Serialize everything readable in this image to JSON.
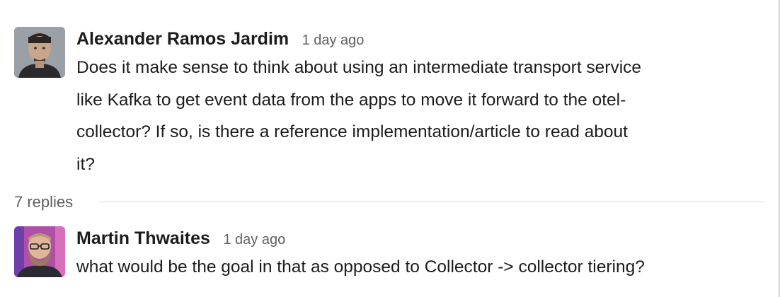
{
  "thread": {
    "parent": {
      "author": "Alexander Ramos Jardim",
      "timestamp": "1 day ago",
      "avatar_icon": "user-avatar-photo",
      "text_lines": [
        "Does it make sense to think about using an intermediate transport service",
        "like Kafka to get event data from the apps to move it forward to the otel-",
        "collector?  If so, is there a reference implementation/article to read about",
        "it?"
      ]
    },
    "replies_label": "7 replies",
    "reply": {
      "author": "Martin Thwaites",
      "timestamp": "1 day ago",
      "avatar_icon": "user-avatar-photo",
      "text_lines": [
        "what would be the goal in that as opposed to Collector -> collector tiering?"
      ]
    }
  },
  "colors": {
    "author": "#1d1c1d",
    "timestamp": "#616061",
    "divider": "#dddddd"
  }
}
